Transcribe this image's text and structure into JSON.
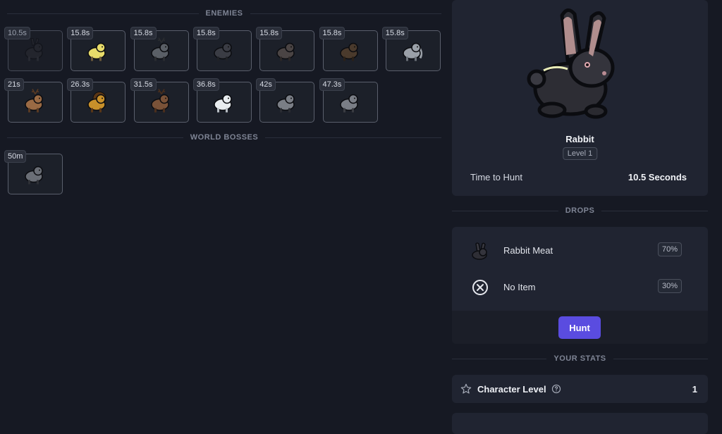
{
  "sections": {
    "enemies": "ENEMIES",
    "world_bosses": "WORLD BOSSES",
    "drops": "DROPS",
    "your_stats": "YOUR STATS"
  },
  "enemies": [
    {
      "timer": "10.5s",
      "animal": "rabbit"
    },
    {
      "timer": "15.8s",
      "animal": "duck"
    },
    {
      "timer": "15.8s",
      "animal": "deer"
    },
    {
      "timer": "15.8s",
      "animal": "bear"
    },
    {
      "timer": "15.8s",
      "animal": "boar"
    },
    {
      "timer": "15.8s",
      "animal": "bison"
    },
    {
      "timer": "15.8s",
      "animal": "elephant"
    },
    {
      "timer": "21s",
      "animal": "elk"
    },
    {
      "timer": "26.3s",
      "animal": "lion"
    },
    {
      "timer": "31.5s",
      "animal": "moose"
    },
    {
      "timer": "36.8s",
      "animal": "polar-bear"
    },
    {
      "timer": "42s",
      "animal": "raccoon"
    },
    {
      "timer": "47.3s",
      "animal": "wolf"
    }
  ],
  "world_bosses": [
    {
      "timer": "50m",
      "animal": "wolf-boss"
    }
  ],
  "selected": {
    "name": "Rabbit",
    "level": "Level 1",
    "time_label": "Time to Hunt",
    "time_value": "10.5 Seconds"
  },
  "drops": [
    {
      "icon": "rabbit-meat-icon",
      "label": "Rabbit Meat",
      "chance": "70%"
    },
    {
      "icon": "no-item-icon",
      "label": "No Item",
      "chance": "30%"
    }
  ],
  "hunt_label": "Hunt",
  "stats": {
    "character_level_label": "Character Level",
    "character_level_value": "1"
  },
  "colors": {
    "background": "#161923",
    "panel": "#202431",
    "accent": "#5a4ce0"
  }
}
